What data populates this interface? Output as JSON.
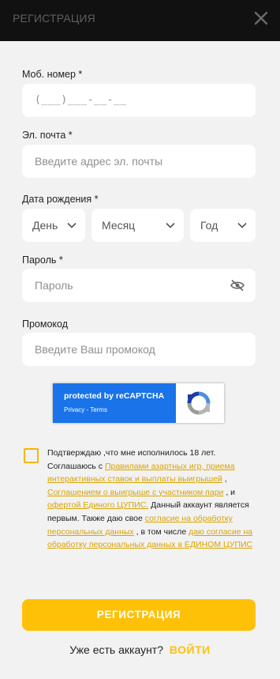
{
  "header": {
    "title": "РЕГИСТРАЦИЯ",
    "close_icon": "close-icon"
  },
  "form": {
    "phone": {
      "label": "Моб. номер *",
      "placeholder": "(___)___-__-__"
    },
    "email": {
      "label": "Эл. почта *",
      "placeholder": "Введите адрес эл. почты"
    },
    "birthdate": {
      "label": "Дата рождения *",
      "day": "День",
      "month": "Месяц",
      "year": "Год"
    },
    "password": {
      "label": "Пароль *",
      "placeholder": "Пароль",
      "toggle_icon": "eye-off-icon"
    },
    "promo": {
      "label": "Промокод",
      "placeholder": "Введите Ваш промокод"
    }
  },
  "captcha": {
    "title": "protected by reCAPTCHA",
    "links": "Privacy - Terms"
  },
  "terms": {
    "checked": false,
    "t1": "Подтверждаю ,что мне исполнилось 18 лет. Соглашаюсь с ",
    "l1": "Правилами азартных игр, приема интерактивных ставок и выплаты выигрышей",
    "t2": " , ",
    "l2": "Соглашением о выигрыше с участником пари",
    "t3": " , и ",
    "l3": "офертой Единого ЦУПИС.",
    "t4": " Данный аккаунт является первым. Также даю свое ",
    "l4": "согласие на обработку персональных данных",
    "t5": " , в том числе ",
    "l5": "даю согласие на обработку персональных данных в ЕДИНОМ ЦУПИС"
  },
  "submit_label": "РЕГИСТРАЦИЯ",
  "login": {
    "question": "Уже есть аккаунт?",
    "link": "ВОЙТИ"
  },
  "colors": {
    "accent": "#ffc107",
    "header_bg": "#111111",
    "page_bg": "#f2f2f2",
    "captcha_blue": "#1a73e8"
  }
}
